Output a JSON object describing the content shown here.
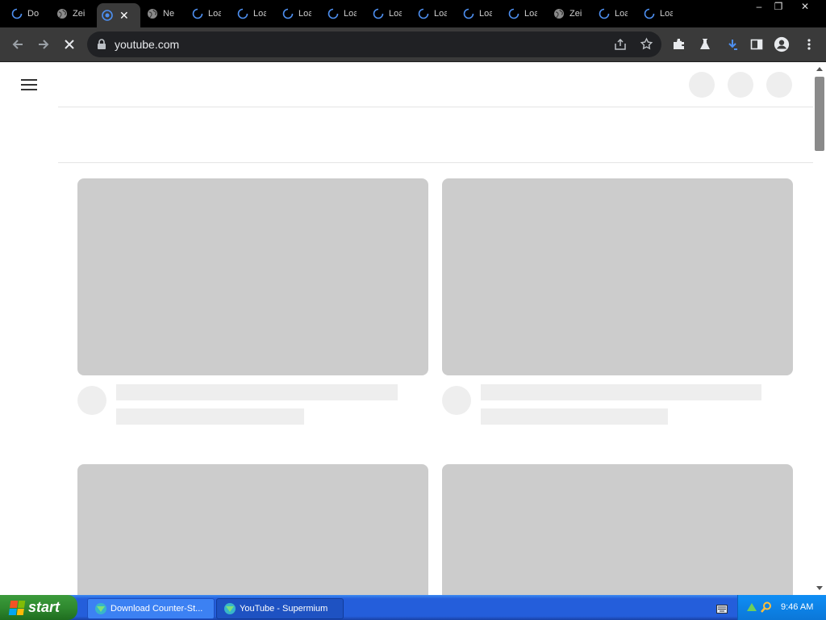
{
  "tabs": [
    {
      "label": "Do",
      "icon": "loading-spinner-icon"
    },
    {
      "label": "Zei",
      "icon": "globe-icon"
    },
    {
      "label": "",
      "icon": "chromium-icon",
      "active": true
    },
    {
      "label": "Ne",
      "icon": "globe-icon"
    },
    {
      "label": "Loa",
      "icon": "loading-spinner-icon"
    },
    {
      "label": "Loa",
      "icon": "loading-spinner-icon"
    },
    {
      "label": "Loa",
      "icon": "loading-spinner-icon"
    },
    {
      "label": "Loa",
      "icon": "loading-spinner-icon"
    },
    {
      "label": "Loa",
      "icon": "loading-spinner-icon"
    },
    {
      "label": "Loa",
      "icon": "loading-spinner-icon"
    },
    {
      "label": "Loa",
      "icon": "loading-spinner-icon"
    },
    {
      "label": "Loa",
      "icon": "loading-spinner-icon"
    },
    {
      "label": "Zei",
      "icon": "globe-icon"
    },
    {
      "label": "Loa",
      "icon": "loading-spinner-icon"
    },
    {
      "label": "Loa",
      "icon": "loading-spinner-icon"
    }
  ],
  "window_controls": {
    "minimize": "–",
    "restore": "❐",
    "close": "✕"
  },
  "toolbar": {
    "url": "youtube.com",
    "icons": [
      "back-arrow-icon",
      "forward-arrow-icon",
      "stop-loading-icon",
      "lock-icon",
      "share-icon",
      "star-icon",
      "extensions-icon",
      "labs-flask-icon",
      "download-icon",
      "side-panel-icon",
      "profile-icon",
      "more-menu-icon"
    ]
  },
  "taskbar": {
    "start_label": "start",
    "items": [
      {
        "label": "Download Counter-St...",
        "active": false
      },
      {
        "label": "YouTube - Supermium",
        "active": true
      }
    ],
    "clock": "9:46 AM"
  },
  "colors": {
    "tab_strip": "#000000",
    "toolbar": "#3a3a3a",
    "omnibox": "#202124",
    "skeleton_thumb": "#cccccc",
    "skeleton_light": "#eeeeee",
    "taskbar_blue": "#245edb",
    "start_green": "#2f8a2f",
    "download_accent": "#4d8ff0"
  }
}
